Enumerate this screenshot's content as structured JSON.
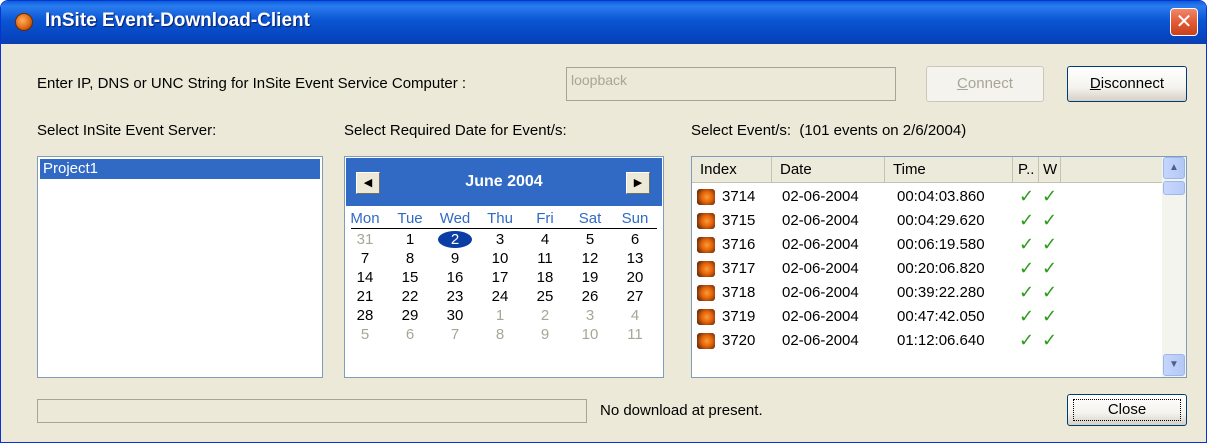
{
  "window": {
    "title": "InSite Event-Download-Client",
    "close_glyph": "✕"
  },
  "connection": {
    "label": "Enter IP, DNS or UNC String for InSite Event Service Computer :",
    "value": "loopback",
    "connect_label": "Connect",
    "connect_mnemonic": "C",
    "connect_rest": "onnect",
    "disconnect_mnemonic": "D",
    "disconnect_rest": "isconnect"
  },
  "server_panel": {
    "label": "Select InSite Event Server:",
    "items": [
      "Project1"
    ]
  },
  "calendar": {
    "label": "Select Required Date for Event/s:",
    "month_title": "June 2004",
    "prev_glyph": "◀",
    "next_glyph": "▶",
    "weekdays": [
      "Mon",
      "Tue",
      "Wed",
      "Thu",
      "Fri",
      "Sat",
      "Sun"
    ],
    "weeks": [
      [
        "31",
        "1",
        "2",
        "3",
        "4",
        "5",
        "6"
      ],
      [
        "7",
        "8",
        "9",
        "10",
        "11",
        "12",
        "13"
      ],
      [
        "14",
        "15",
        "16",
        "17",
        "18",
        "19",
        "20"
      ],
      [
        "21",
        "22",
        "23",
        "24",
        "25",
        "26",
        "27"
      ],
      [
        "28",
        "29",
        "30",
        "1",
        "2",
        "3",
        "4"
      ],
      [
        "5",
        "6",
        "7",
        "8",
        "9",
        "10",
        "11"
      ]
    ],
    "selected": "2"
  },
  "events": {
    "label": "Select Event/s:",
    "count_text": "(101 events on 2/6/2004)",
    "columns": [
      "Index",
      "Date",
      "Time",
      "P..",
      "W"
    ],
    "check_glyph": "✓",
    "rows": [
      {
        "index": "3714",
        "date": "02-06-2004",
        "time": "00:04:03.860"
      },
      {
        "index": "3715",
        "date": "02-06-2004",
        "time": "00:04:29.620"
      },
      {
        "index": "3716",
        "date": "02-06-2004",
        "time": "00:06:19.580"
      },
      {
        "index": "3717",
        "date": "02-06-2004",
        "time": "00:20:06.820"
      },
      {
        "index": "3718",
        "date": "02-06-2004",
        "time": "00:39:22.280"
      },
      {
        "index": "3719",
        "date": "02-06-2004",
        "time": "00:47:42.050"
      },
      {
        "index": "3720",
        "date": "02-06-2004",
        "time": "01:12:06.640"
      }
    ],
    "scroll_up_glyph": "▲",
    "scroll_down_glyph": "▼"
  },
  "footer": {
    "progress": 0,
    "status_text": "No download at present.",
    "close_label": "Close"
  }
}
